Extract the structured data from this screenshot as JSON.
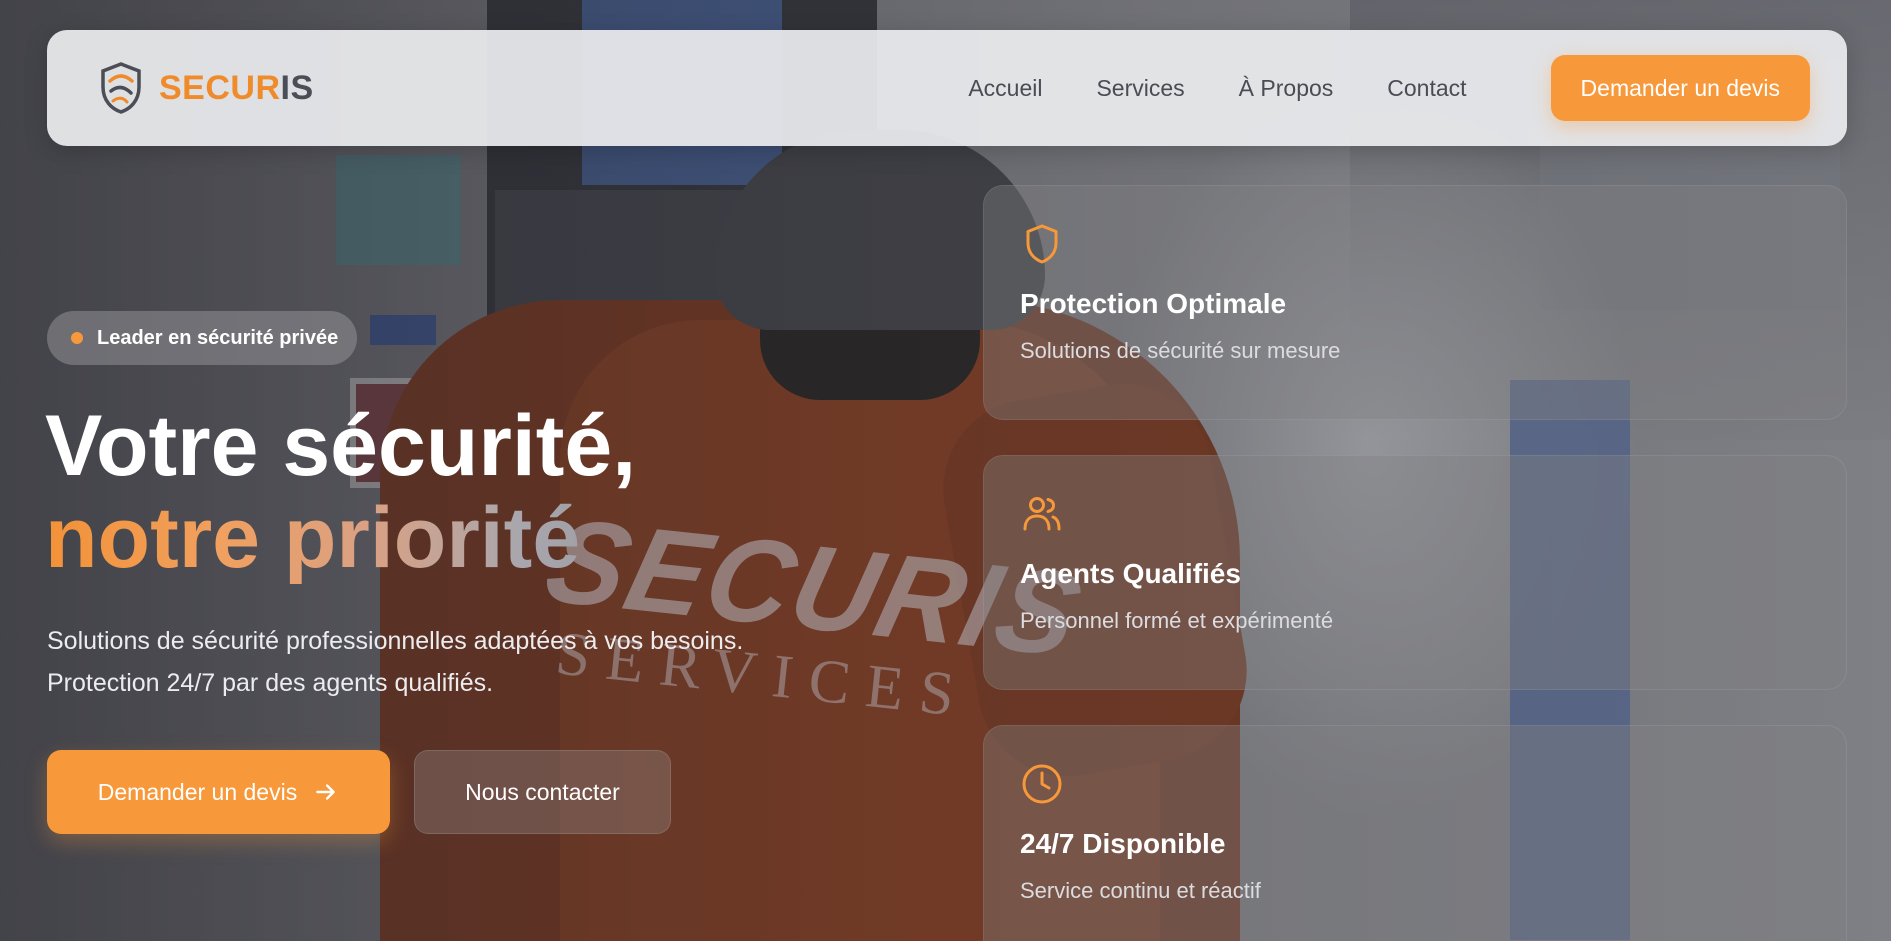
{
  "brand": {
    "name_part1": "SECUR",
    "name_part2": "IS",
    "logo_icon": "shield-logo-icon"
  },
  "nav": {
    "links": [
      "Accueil",
      "Services",
      "À Propos",
      "Contact"
    ],
    "cta_label": "Demander un devis"
  },
  "hero": {
    "badge": "Leader en sécurité privée",
    "title_line1": "Votre sécurité,",
    "title_line2": "notre priorité",
    "description_line1": "Solutions de sécurité professionnelles adaptées à vos besoins.",
    "description_line2": "Protection 24/7 par des agents qualifiés.",
    "primary_button": "Demander un devis",
    "secondary_button": "Nous contacter"
  },
  "features": [
    {
      "icon": "shield-icon",
      "title": "Protection Optimale",
      "subtitle": "Solutions de sécurité sur mesure"
    },
    {
      "icon": "users-icon",
      "title": "Agents Qualifiés",
      "subtitle": "Personnel formé et expérimenté"
    },
    {
      "icon": "clock-icon",
      "title": "24/7 Disponible",
      "subtitle": "Service continu et réactif"
    }
  ],
  "background_photo": {
    "jacket_text_main": "SECURIS",
    "jacket_text_sub": "SERVICES"
  },
  "colors": {
    "accent": "#f7983a",
    "brand_dark": "#4b4d57",
    "text_light": "#ffffff"
  }
}
